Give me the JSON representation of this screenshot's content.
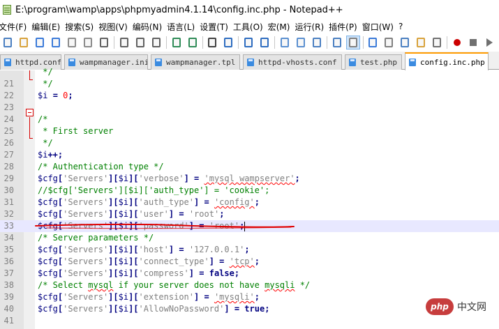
{
  "window": {
    "title": "E:\\program\\wamp\\apps\\phpmyadmin4.1.14\\config.inc.php - Notepad++"
  },
  "menu": [
    "文件(F)",
    "编辑(E)",
    "搜索(S)",
    "视图(V)",
    "编码(N)",
    "语言(L)",
    "设置(T)",
    "工具(O)",
    "宏(M)",
    "运行(R)",
    "插件(P)",
    "窗口(W)",
    "?"
  ],
  "toolbar": {
    "icons": [
      "new-file-icon",
      "open-file-icon",
      "save-icon",
      "save-all-icon",
      "close-icon",
      "close-all-icon",
      "print-icon",
      "cut-icon",
      "copy-icon",
      "paste-icon",
      "undo-icon",
      "redo-icon",
      "find-icon",
      "replace-icon",
      "zoom-in-icon",
      "zoom-out-icon",
      "sync-vertical-icon",
      "sync-horizontal-icon",
      "word-wrap-icon",
      "show-all-chars-icon",
      "indent-guide-icon",
      "user-lang-icon",
      "doc-map-icon",
      "function-list-icon",
      "folder-workspace-icon",
      "monitoring-icon",
      "record-macro-icon",
      "stop-record-icon",
      "play-macro-icon"
    ]
  },
  "tabs": [
    {
      "label": "httpd.conf",
      "active": false
    },
    {
      "label": "wampmanager.ini",
      "active": false
    },
    {
      "label": "wampmanager.tpl",
      "active": false
    },
    {
      "label": "httpd-vhosts.conf",
      "active": false
    },
    {
      "label": "test.php",
      "active": false
    },
    {
      "label": "config.inc.php",
      "active": true
    }
  ],
  "editor": {
    "current_line": 33,
    "lines": [
      {
        "num": "",
        "tokens": [
          {
            "t": "comment",
            "v": " */"
          }
        ]
      },
      {
        "num": "21",
        "tokens": [
          {
            "t": "comment",
            "v": " */"
          }
        ]
      },
      {
        "num": "22",
        "tokens": [
          {
            "t": "var",
            "v": "$i"
          },
          {
            "t": "plain",
            "v": " "
          },
          {
            "t": "op",
            "v": "="
          },
          {
            "t": "plain",
            "v": " "
          },
          {
            "t": "num",
            "v": "0"
          },
          {
            "t": "op",
            "v": ";"
          }
        ]
      },
      {
        "num": "23",
        "tokens": []
      },
      {
        "num": "24",
        "tokens": [
          {
            "t": "comment",
            "v": "/*"
          }
        ]
      },
      {
        "num": "25",
        "tokens": [
          {
            "t": "comment",
            "v": " * First server"
          }
        ]
      },
      {
        "num": "26",
        "tokens": [
          {
            "t": "comment",
            "v": " */"
          }
        ]
      },
      {
        "num": "27",
        "tokens": [
          {
            "t": "var",
            "v": "$i"
          },
          {
            "t": "op",
            "v": "++;"
          }
        ]
      },
      {
        "num": "28",
        "tokens": [
          {
            "t": "comment",
            "v": "/* Authentication type */"
          }
        ]
      },
      {
        "num": "29",
        "tokens": [
          {
            "t": "var",
            "v": "$cfg"
          },
          {
            "t": "op",
            "v": "["
          },
          {
            "t": "str",
            "v": "'Servers'"
          },
          {
            "t": "op",
            "v": "]["
          },
          {
            "t": "var",
            "v": "$i"
          },
          {
            "t": "op",
            "v": "]["
          },
          {
            "t": "str",
            "v": "'verbose'"
          },
          {
            "t": "op",
            "v": "]"
          },
          {
            "t": "plain",
            "v": " "
          },
          {
            "t": "op",
            "v": "="
          },
          {
            "t": "plain",
            "v": " "
          },
          {
            "t": "str",
            "v": "'mysql wampserver'",
            "sq": true
          },
          {
            "t": "op",
            "v": ";"
          }
        ]
      },
      {
        "num": "30",
        "tokens": [
          {
            "t": "comment",
            "v": "//$cfg['Servers'][$i]['auth_type'] = 'cookie';"
          }
        ]
      },
      {
        "num": "31",
        "tokens": [
          {
            "t": "var",
            "v": "$cfg"
          },
          {
            "t": "op",
            "v": "["
          },
          {
            "t": "str",
            "v": "'Servers'"
          },
          {
            "t": "op",
            "v": "]["
          },
          {
            "t": "var",
            "v": "$i"
          },
          {
            "t": "op",
            "v": "]["
          },
          {
            "t": "str",
            "v": "'auth_type'"
          },
          {
            "t": "op",
            "v": "]"
          },
          {
            "t": "plain",
            "v": " "
          },
          {
            "t": "op",
            "v": "="
          },
          {
            "t": "plain",
            "v": " "
          },
          {
            "t": "str",
            "v": "'config'",
            "sq": true
          },
          {
            "t": "op",
            "v": ";"
          }
        ]
      },
      {
        "num": "32",
        "tokens": [
          {
            "t": "var",
            "v": "$cfg"
          },
          {
            "t": "op",
            "v": "["
          },
          {
            "t": "str",
            "v": "'Servers'"
          },
          {
            "t": "op",
            "v": "]["
          },
          {
            "t": "var",
            "v": "$i"
          },
          {
            "t": "op",
            "v": "]["
          },
          {
            "t": "str",
            "v": "'user'"
          },
          {
            "t": "op",
            "v": "]"
          },
          {
            "t": "plain",
            "v": " "
          },
          {
            "t": "op",
            "v": "="
          },
          {
            "t": "plain",
            "v": " "
          },
          {
            "t": "str",
            "v": "'root'"
          },
          {
            "t": "op",
            "v": ";"
          }
        ]
      },
      {
        "num": "33",
        "tokens": [
          {
            "t": "var",
            "v": "$cfg"
          },
          {
            "t": "op",
            "v": "["
          },
          {
            "t": "str",
            "v": "'Servers'"
          },
          {
            "t": "op",
            "v": "]["
          },
          {
            "t": "var",
            "v": "$i"
          },
          {
            "t": "op",
            "v": "]["
          },
          {
            "t": "str",
            "v": "'password'"
          },
          {
            "t": "op",
            "v": "]"
          },
          {
            "t": "plain",
            "v": " "
          },
          {
            "t": "op",
            "v": "="
          },
          {
            "t": "plain",
            "v": " "
          },
          {
            "t": "str",
            "v": "'root'"
          },
          {
            "t": "op",
            "v": ";"
          }
        ]
      },
      {
        "num": "34",
        "tokens": [
          {
            "t": "comment",
            "v": "/* Server parameters */"
          }
        ]
      },
      {
        "num": "35",
        "tokens": [
          {
            "t": "var",
            "v": "$cfg"
          },
          {
            "t": "op",
            "v": "["
          },
          {
            "t": "str",
            "v": "'Servers'"
          },
          {
            "t": "op",
            "v": "]["
          },
          {
            "t": "var",
            "v": "$i"
          },
          {
            "t": "op",
            "v": "]["
          },
          {
            "t": "str",
            "v": "'host'"
          },
          {
            "t": "op",
            "v": "]"
          },
          {
            "t": "plain",
            "v": " "
          },
          {
            "t": "op",
            "v": "="
          },
          {
            "t": "plain",
            "v": " "
          },
          {
            "t": "str",
            "v": "'127.0.0.1'"
          },
          {
            "t": "op",
            "v": ";"
          }
        ]
      },
      {
        "num": "36",
        "tokens": [
          {
            "t": "var",
            "v": "$cfg"
          },
          {
            "t": "op",
            "v": "["
          },
          {
            "t": "str",
            "v": "'Servers'"
          },
          {
            "t": "op",
            "v": "]["
          },
          {
            "t": "var",
            "v": "$i"
          },
          {
            "t": "op",
            "v": "]["
          },
          {
            "t": "str",
            "v": "'connect_type'"
          },
          {
            "t": "op",
            "v": "]"
          },
          {
            "t": "plain",
            "v": " "
          },
          {
            "t": "op",
            "v": "="
          },
          {
            "t": "plain",
            "v": " "
          },
          {
            "t": "str",
            "v": "'tcp'",
            "sq": true
          },
          {
            "t": "op",
            "v": ";"
          }
        ]
      },
      {
        "num": "37",
        "tokens": [
          {
            "t": "var",
            "v": "$cfg"
          },
          {
            "t": "op",
            "v": "["
          },
          {
            "t": "str",
            "v": "'Servers'"
          },
          {
            "t": "op",
            "v": "]["
          },
          {
            "t": "var",
            "v": "$i"
          },
          {
            "t": "op",
            "v": "]["
          },
          {
            "t": "str",
            "v": "'compress'"
          },
          {
            "t": "op",
            "v": "]"
          },
          {
            "t": "plain",
            "v": " "
          },
          {
            "t": "op",
            "v": "="
          },
          {
            "t": "plain",
            "v": " "
          },
          {
            "t": "kw",
            "v": "false"
          },
          {
            "t": "op",
            "v": ";"
          }
        ]
      },
      {
        "num": "38",
        "tokens": [
          {
            "t": "comment",
            "v": "/* Select "
          },
          {
            "t": "comment",
            "v": "mysql",
            "sq": true
          },
          {
            "t": "comment",
            "v": " if your server does not have "
          },
          {
            "t": "comment",
            "v": "mysqli",
            "sq": true
          },
          {
            "t": "comment",
            "v": " */"
          }
        ]
      },
      {
        "num": "39",
        "tokens": [
          {
            "t": "var",
            "v": "$cfg"
          },
          {
            "t": "op",
            "v": "["
          },
          {
            "t": "str",
            "v": "'Servers'"
          },
          {
            "t": "op",
            "v": "]["
          },
          {
            "t": "var",
            "v": "$i"
          },
          {
            "t": "op",
            "v": "]["
          },
          {
            "t": "str",
            "v": "'extension'"
          },
          {
            "t": "op",
            "v": "]"
          },
          {
            "t": "plain",
            "v": " "
          },
          {
            "t": "op",
            "v": "="
          },
          {
            "t": "plain",
            "v": " "
          },
          {
            "t": "str",
            "v": "'mysqli'",
            "sq": true
          },
          {
            "t": "op",
            "v": ";"
          }
        ]
      },
      {
        "num": "40",
        "tokens": [
          {
            "t": "var",
            "v": "$cfg"
          },
          {
            "t": "op",
            "v": "["
          },
          {
            "t": "str",
            "v": "'Servers'"
          },
          {
            "t": "op",
            "v": "]["
          },
          {
            "t": "var",
            "v": "$i"
          },
          {
            "t": "op",
            "v": "]["
          },
          {
            "t": "str",
            "v": "'AllowNoPassword'"
          },
          {
            "t": "op",
            "v": "]"
          },
          {
            "t": "plain",
            "v": " "
          },
          {
            "t": "op",
            "v": "="
          },
          {
            "t": "plain",
            "v": " "
          },
          {
            "t": "kw",
            "v": "true"
          },
          {
            "t": "op",
            "v": ";"
          }
        ]
      },
      {
        "num": "41",
        "tokens": []
      }
    ]
  },
  "colors": {
    "annotation": "#e00000",
    "active_tab_accent": "#ff9b00",
    "current_line_bg": "#e8e8ff"
  },
  "watermark": {
    "logo": "php",
    "text": "中文网"
  }
}
